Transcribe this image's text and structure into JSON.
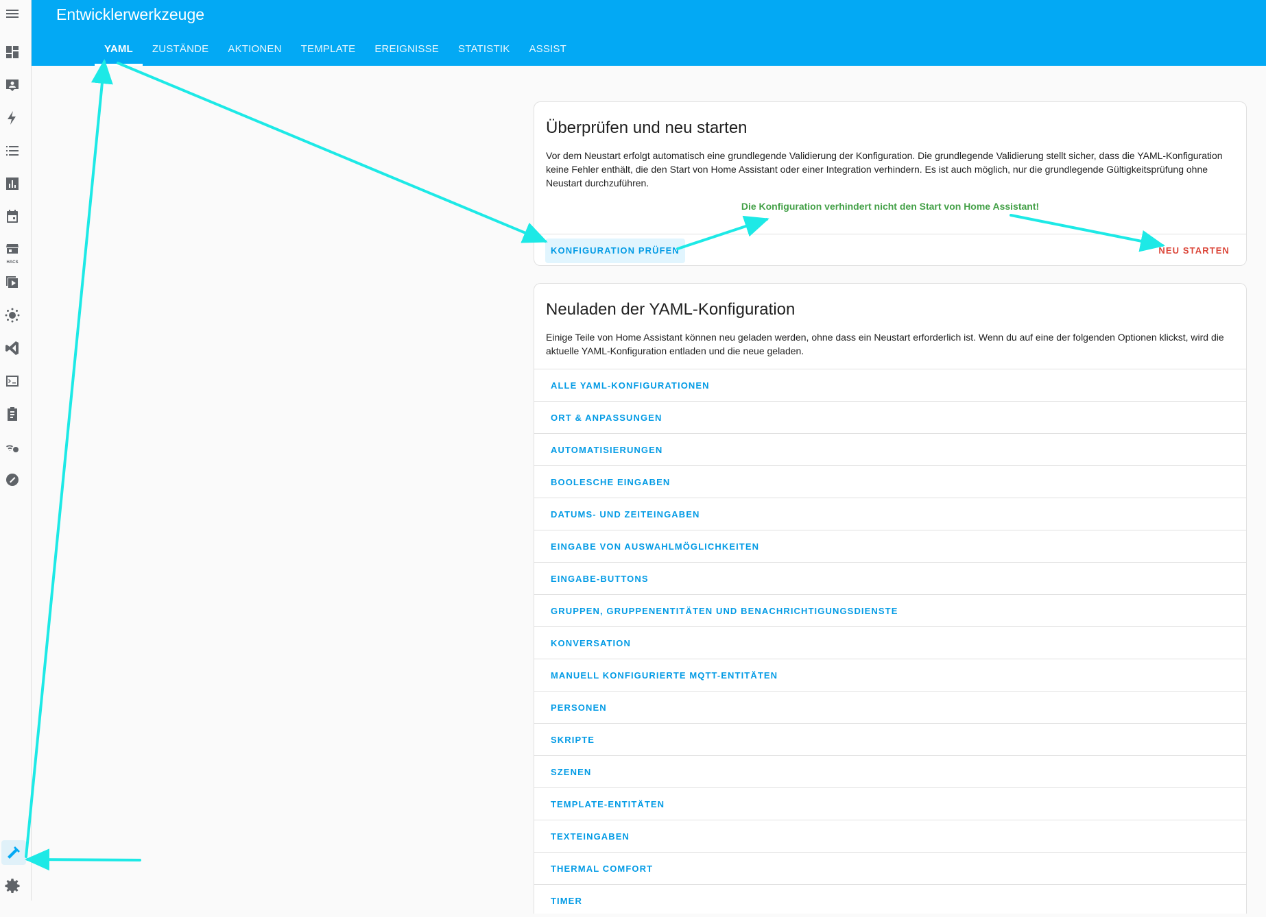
{
  "app": {
    "title": "Entwicklerwerkzeuge"
  },
  "tabs": [
    {
      "label": "YAML",
      "active": true
    },
    {
      "label": "ZUSTÄNDE"
    },
    {
      "label": "AKTIONEN"
    },
    {
      "label": "TEMPLATE"
    },
    {
      "label": "EREIGNISSE"
    },
    {
      "label": "STATISTIK"
    },
    {
      "label": "ASSIST"
    }
  ],
  "sidebar": {
    "icons": [
      "menu-icon",
      "dashboard-icon",
      "person-card-icon",
      "lightning-icon",
      "list-icon",
      "chart-icon",
      "calendar-icon",
      "hacs-icon",
      "media-icon",
      "bulb-icon",
      "vscode-icon",
      "terminal-icon",
      "clipboard-icon",
      "zigbee-icon",
      "zwave-icon",
      "hammer-icon",
      "gear-icon"
    ],
    "active": "hammer-icon",
    "hacs_caption": "HACS"
  },
  "check_card": {
    "title": "Überprüfen und neu starten",
    "description": "Vor dem Neustart erfolgt automatisch eine grundlegende Validierung der Konfiguration. Die grundlegende Validierung stellt sicher, dass die YAML-Konfiguration keine Fehler enthält, die den Start von Home Assistant oder einer Integration verhindern. Es ist auch möglich, nur die grundlegende Gültigkeitsprüfung ohne Neustart durchzuführen.",
    "result": "Die Konfiguration verhindert nicht den Start von Home Assistant!",
    "check_button": "KONFIGURATION PRÜFEN",
    "restart_button": "NEU STARTEN"
  },
  "reload_card": {
    "title": "Neuladen der YAML-Konfiguration",
    "description": "Einige Teile von Home Assistant können neu geladen werden, ohne dass ein Neustart erforderlich ist. Wenn du auf eine der folgenden Optionen klickst, wird die aktuelle YAML-Konfiguration entladen und die neue geladen.",
    "items": [
      "ALLE YAML-KONFIGURATIONEN",
      "ORT & ANPASSUNGEN",
      "AUTOMATISIERUNGEN",
      "BOOLESCHE EINGABEN",
      "DATUMS- UND ZEITEINGABEN",
      "EINGABE VON AUSWAHLMÖGLICHKEITEN",
      "EINGABE-BUTTONS",
      "GRUPPEN, GRUPPENENTITÄTEN UND BENACHRICHTIGUNGSDIENSTE",
      "KONVERSATION",
      "MANUELL KONFIGURIERTE MQTT-ENTITÄTEN",
      "PERSONEN",
      "SKRIPTE",
      "SZENEN",
      "TEMPLATE-ENTITÄTEN",
      "TEXTEINGABEN",
      "THERMAL COMFORT",
      "TIMER"
    ]
  },
  "colors": {
    "primary": "#03a9f4",
    "success": "#43a047",
    "danger": "#db4437",
    "annotation": "#1de9e6"
  }
}
